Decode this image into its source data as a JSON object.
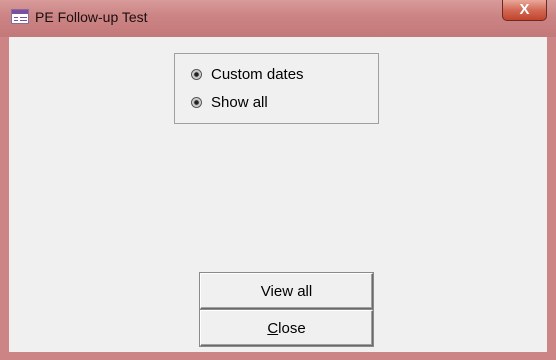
{
  "window": {
    "title": "PE Follow-up Test",
    "close_label": "X"
  },
  "options": {
    "items": [
      {
        "label": "Custom dates"
      },
      {
        "label": "Show all"
      }
    ]
  },
  "buttons": {
    "view_all_label": "View all",
    "close_mnemonic": "C",
    "close_rest": "lose"
  },
  "colors": {
    "frame": "#cd8484",
    "client_background": "#f0f0f0",
    "close_button": "#c2442d"
  }
}
